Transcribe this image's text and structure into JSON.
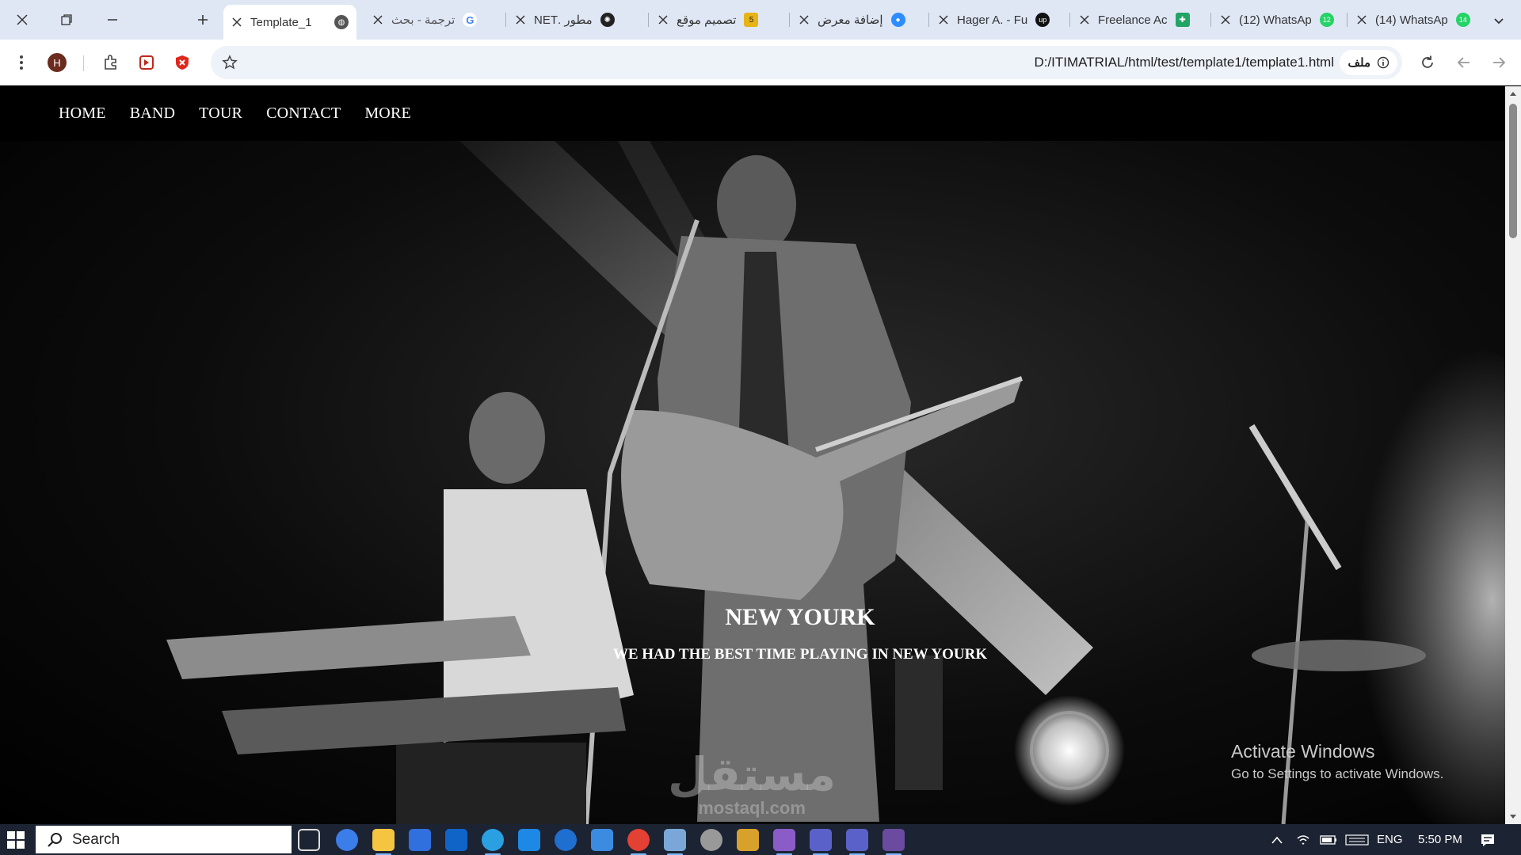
{
  "browser": {
    "tabs": [
      {
        "title": "Template_1",
        "active": true
      },
      {
        "title": "ترجمة - بحث",
        "active": false
      },
      {
        "title": "مطور .NET",
        "active": false
      },
      {
        "title": "تصميم موقع",
        "active": false
      },
      {
        "title": "إضافة معرض",
        "active": false
      },
      {
        "title": "Hager A. - Fu",
        "active": false
      },
      {
        "title": "Freelance Ac",
        "active": false
      },
      {
        "title": "(12) WhatsAp",
        "active": false
      },
      {
        "title": "(14) WhatsAp",
        "active": false
      }
    ],
    "tab_badges": {
      "t4": "5",
      "t8": "12",
      "t9": "14"
    },
    "profile_initial": "H",
    "url": "D:/ITIMATRIAL/html/test/template1/template1.html",
    "site_chip_label": "ملف"
  },
  "nav": {
    "items": [
      "HOME",
      "BAND",
      "TOUR",
      "CONTACT",
      "MORE"
    ]
  },
  "hero": {
    "title": "NEW YOURK",
    "subtitle": "WE HAD THE BEST TIME PLAYING IN NEW YOURK"
  },
  "overlays": {
    "activate_title": "Activate Windows",
    "activate_sub": "Go to Settings to activate Windows.",
    "watermark_ar": "مستقل",
    "watermark_en": "mostaql.com"
  },
  "taskbar": {
    "search_label": "Search",
    "lang": "ENG",
    "time": "5:50 PM"
  },
  "colors": {
    "tabstrip_bg": "#dfe7f5",
    "page_bg": "#000000",
    "taskbar_bg": "#1c2332"
  }
}
